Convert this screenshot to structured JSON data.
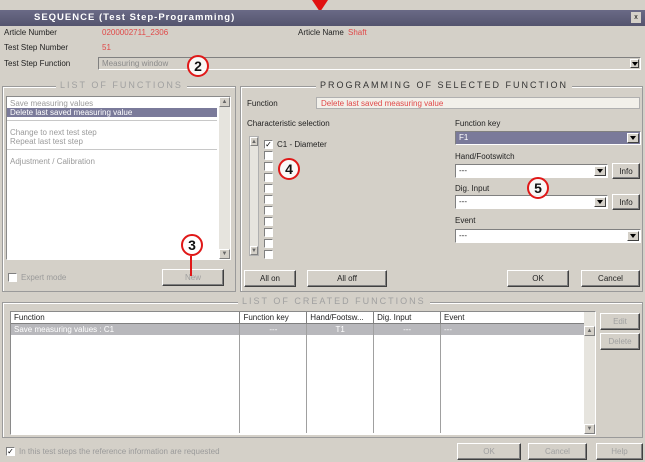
{
  "window": {
    "title": "SEQUENCE (Test Step-Programming)",
    "close_glyph": "x"
  },
  "header": {
    "article_number_label": "Article Number",
    "article_number_value": "0200002711_2306",
    "article_name_label": "Article Name",
    "article_name_value": "Shaft",
    "test_step_number_label": "Test Step Number",
    "test_step_number_value": "51",
    "test_step_function_label": "Test Step Function",
    "test_step_function_value": "Measuring window"
  },
  "list_of_functions": {
    "title": "LIST OF FUNCTIONS",
    "items": [
      {
        "label": "Save measuring values",
        "selected": false
      },
      {
        "label": "Delete last saved measuring value",
        "selected": true
      },
      {
        "label": "",
        "selected": false
      },
      {
        "label": "Change to next test step",
        "selected": false
      },
      {
        "label": "Repeat last test step",
        "selected": false
      },
      {
        "label": "",
        "selected": false
      },
      {
        "label": "Adjustment / Calibration",
        "selected": false
      }
    ],
    "expert_mode_label": "Expert mode",
    "new_button": "New"
  },
  "programming": {
    "title": "PROGRAMMING OF SELECTED FUNCTION",
    "function_label": "Function",
    "function_value": "Delete last saved measuring value",
    "characteristic_selection_label": "Characteristic selection",
    "characteristics": [
      {
        "label": "C1 - Diameter",
        "checked": true
      },
      {
        "label": "",
        "checked": false
      },
      {
        "label": "",
        "checked": false
      },
      {
        "label": "",
        "checked": false
      },
      {
        "label": "",
        "checked": false
      },
      {
        "label": "",
        "checked": false
      },
      {
        "label": "",
        "checked": false
      },
      {
        "label": "",
        "checked": false
      },
      {
        "label": "",
        "checked": false
      },
      {
        "label": "",
        "checked": false
      },
      {
        "label": "",
        "checked": false
      },
      {
        "label": "",
        "checked": false
      }
    ],
    "check_glyph": "✓",
    "function_key_label": "Function key",
    "function_key_value": "F1",
    "hand_footswitch_label": "Hand/Footswitch",
    "hand_footswitch_value": "---",
    "info_button_1": "Info",
    "dig_input_label": "Dig. Input",
    "dig_input_value": "---",
    "info_button_2": "Info",
    "event_label": "Event",
    "event_value": "---",
    "all_on_button": "All on",
    "all_off_button": "All off",
    "ok_button": "OK",
    "cancel_button": "Cancel"
  },
  "created_functions": {
    "title": "LIST OF CREATED FUNCTIONS",
    "columns": [
      "Function",
      "Function key",
      "Hand/Footsw...",
      "Dig. Input",
      "Event"
    ],
    "rows": [
      [
        "Save measuring values : C1",
        "---",
        "T1",
        "---",
        "---"
      ]
    ],
    "edit_button": "Edit",
    "delete_button": "Delete"
  },
  "footer": {
    "reference_info_label": "In this test steps the reference information are requested",
    "reference_info_checked": true,
    "ok_button": "OK",
    "cancel_button": "Cancel",
    "help_button": "Help"
  },
  "annotations": [
    "2",
    "3",
    "4",
    "5"
  ],
  "colors": {
    "title_bar": "#5a5a74",
    "selection": "#7a7a9a",
    "highlight_text": "#e04848",
    "annotation_ring": "#e01818"
  }
}
